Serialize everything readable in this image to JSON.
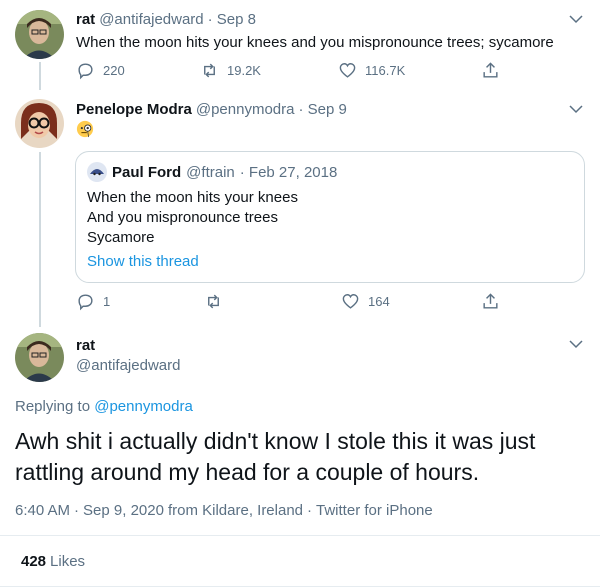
{
  "tweets": [
    {
      "name": "rat",
      "handle": "@antifajedward",
      "date": "· Sep 8",
      "text": "When the moon hits your knees and you mispronounce trees; sycamore",
      "replies": "220",
      "retweets": "19.2K",
      "likes": "116.7K"
    },
    {
      "name": "Penelope Modra",
      "handle": "@pennymodra",
      "date": "· Sep 9",
      "emoji": "🧐",
      "quote": {
        "name": "Paul Ford",
        "handle": "@ftrain",
        "date": "· Feb 27, 2018",
        "lines": [
          "When the moon hits your knees",
          "And you mispronounce trees",
          "Sycamore"
        ],
        "show_thread": "Show this thread"
      },
      "replies": "1",
      "likes": "164"
    }
  ],
  "main": {
    "name": "rat",
    "handle": "@antifajedward",
    "replying_prefix": "Replying to ",
    "replying_handle": "@pennymodra",
    "text": "Awh shit i actually didn't know I stole this it was just rattling around my head for a couple of hours.",
    "time": "6:40 AM",
    "date": "Sep 9, 2020",
    "location": "from Kildare, Ireland",
    "client": "Twitter for iPhone",
    "likes_count": "428",
    "likes_label": "Likes"
  },
  "colors": {
    "accent": "#1b95e0",
    "muted": "#5b7083",
    "divider": "#e6ecf0"
  }
}
